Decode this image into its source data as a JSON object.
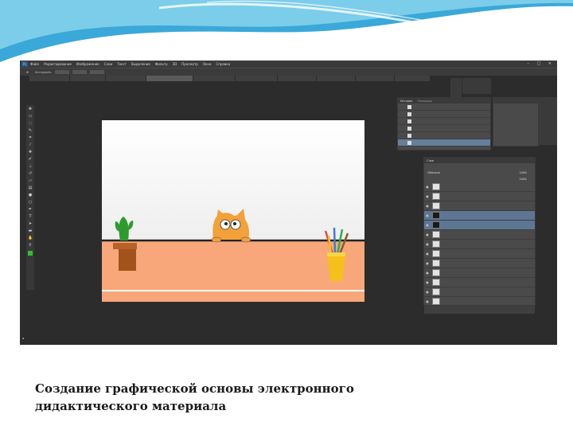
{
  "slide": {
    "caption_line1": "Создание графической основы электронного",
    "caption_line2": "дидактического материала"
  },
  "app": {
    "logo": "Ps",
    "menu": [
      "Файл",
      "Редактирование",
      "Изображение",
      "Слои",
      "Текст",
      "Выделение",
      "Фильтр",
      "3D",
      "Просмотр",
      "Окно",
      "Справка"
    ],
    "options_label": "Интерфейс"
  },
  "history_panel": {
    "tabs": [
      "История",
      "Операции"
    ]
  },
  "layers_panel": {
    "tabs": [
      "Слои"
    ],
    "blend_mode": "Обычные",
    "opacity_label": "100%",
    "fill_label": "100%"
  },
  "colors": {
    "foreground": "#2ec02e",
    "table": "#f7a77a",
    "cactus_pot": "#a2531d",
    "cactus": "#2f9b2f",
    "cat": "#f3a13a",
    "pencil_cup": "#f5c01a"
  },
  "icons": {
    "tools": [
      "move-icon",
      "marquee-icon",
      "lasso-icon",
      "quick-select-icon",
      "crop-icon",
      "eyedropper-icon",
      "healing-icon",
      "brush-icon",
      "clone-stamp-icon",
      "history-brush-icon",
      "eraser-icon",
      "gradient-icon",
      "blur-icon",
      "dodge-icon",
      "pen-icon",
      "type-icon",
      "path-select-icon",
      "shape-icon",
      "hand-icon",
      "zoom-icon"
    ]
  }
}
